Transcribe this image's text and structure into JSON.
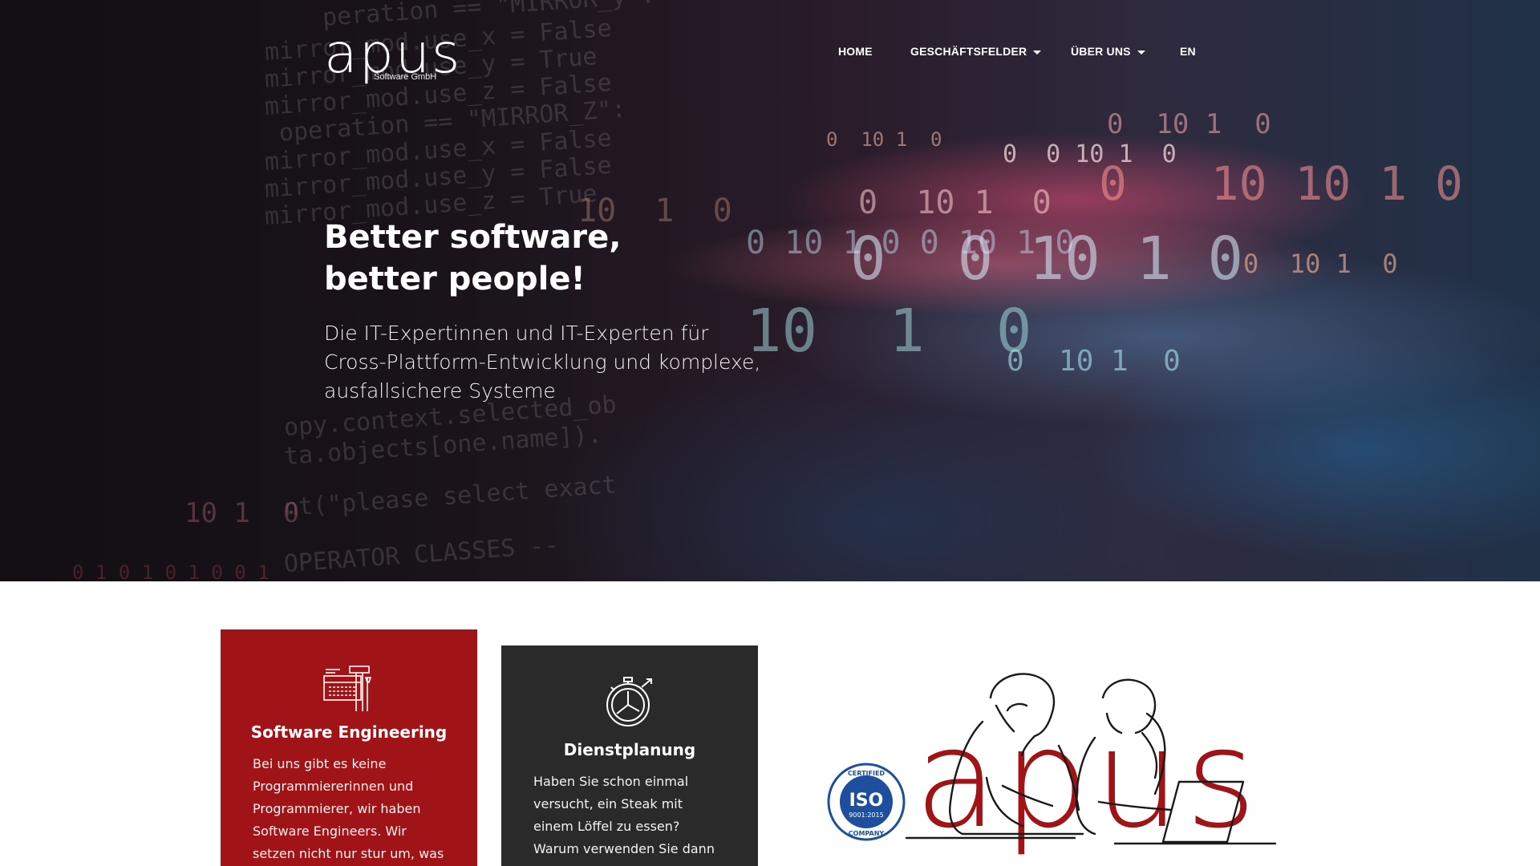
{
  "header": {
    "logo_text": "apus",
    "logo_subtitle": "Software GmbH",
    "nav": [
      {
        "label": "HOME",
        "dropdown": false
      },
      {
        "label": "GESCHÄFTSFELDER",
        "dropdown": true
      },
      {
        "label": "ÜBER UNS",
        "dropdown": true
      },
      {
        "label": "EN",
        "dropdown": false
      }
    ]
  },
  "hero": {
    "headline_line1": "Better software,",
    "headline_line2": "better people!",
    "subline": "Die IT-Expertinnen und IT-Experten für Cross-Plattform-Entwicklung und komplexe, ausfallsichere Systeme"
  },
  "cards": [
    {
      "icon": "keyboard-tools-icon",
      "title": "Software Engineering",
      "text": "Bei uns gibt es keine Programmiererinnen und Programmierer, wir haben Software Engineers. Wir setzen nicht nur stur um, was",
      "color": "#a01418"
    },
    {
      "icon": "stopwatch-icon",
      "title": "Dienstplanung",
      "text": "Haben Sie schon einmal versucht, ein Steak mit einem Löffel zu essen? Warum verwenden Sie dann ein Office-",
      "color": "#2a2a2a"
    }
  ],
  "badge": {
    "top": "CERTIFIED",
    "middle": "ISO",
    "standard": "9001:2015",
    "bottom": "COMPANY"
  },
  "illustration": {
    "icon": "team-at-laptop-illustration",
    "word": "apus"
  },
  "colors": {
    "brand_red": "#a01418",
    "card_dark": "#2a2a2a",
    "iso_blue": "#1d4f9c"
  }
}
